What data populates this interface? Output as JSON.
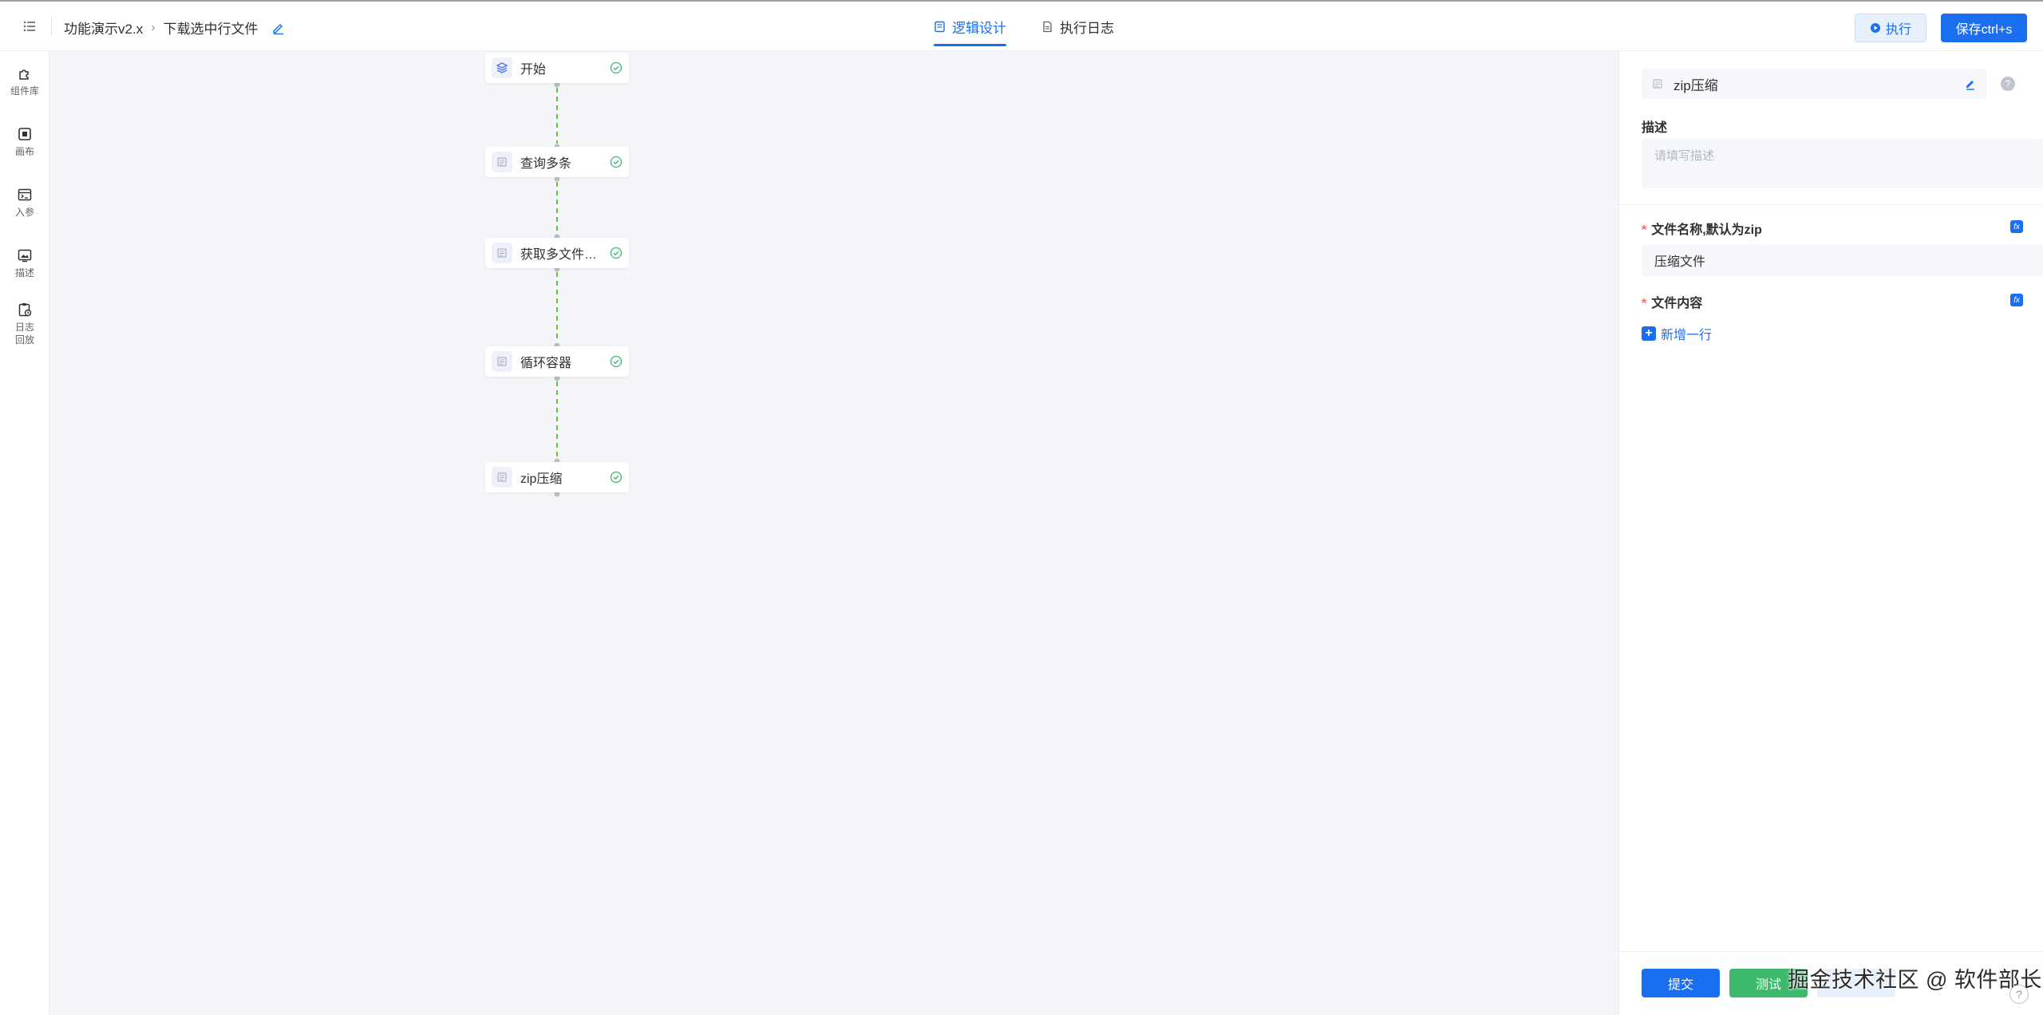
{
  "header": {
    "breadcrumb": {
      "project": "功能演示v2.x",
      "current": "下载选中行文件"
    },
    "tabs": [
      {
        "label": "逻辑设计",
        "active": true
      },
      {
        "label": "执行日志",
        "active": false
      }
    ],
    "run_label": "执行",
    "save_label": "保存ctrl+s"
  },
  "sidebar": {
    "items": [
      {
        "label": "组件库",
        "icon": "puzzle-icon"
      },
      {
        "label": "画布",
        "icon": "canvas-icon"
      },
      {
        "label": "入参",
        "icon": "params-icon"
      },
      {
        "label": "描述",
        "icon": "image-icon"
      },
      {
        "label": "日志回放",
        "icon": "log-replay-icon"
      }
    ]
  },
  "flow": {
    "nodes": [
      {
        "label": "开始",
        "status": "success"
      },
      {
        "label": "查询多条",
        "status": "success"
      },
      {
        "label": "获取多文件地...",
        "status": "success"
      },
      {
        "label": "循环容器",
        "status": "success"
      },
      {
        "label": "zip压缩",
        "status": "success"
      }
    ]
  },
  "panel": {
    "title": "zip压缩",
    "description_label": "描述",
    "description_placeholder": "请填写描述",
    "fields": [
      {
        "label": "文件名称,默认为zip",
        "required": true,
        "value": "压缩文件"
      },
      {
        "label": "文件内容",
        "required": true
      }
    ],
    "add_row_label": "新增一行",
    "fx_label": "fx",
    "footer": {
      "submit": "提交",
      "test": "测试",
      "third": ""
    }
  },
  "watermark": "掘金技术社区 @ 软件部长",
  "colors": {
    "primary": "#1a6ff0",
    "success": "#3cb96a",
    "edge": "#67c23a"
  }
}
